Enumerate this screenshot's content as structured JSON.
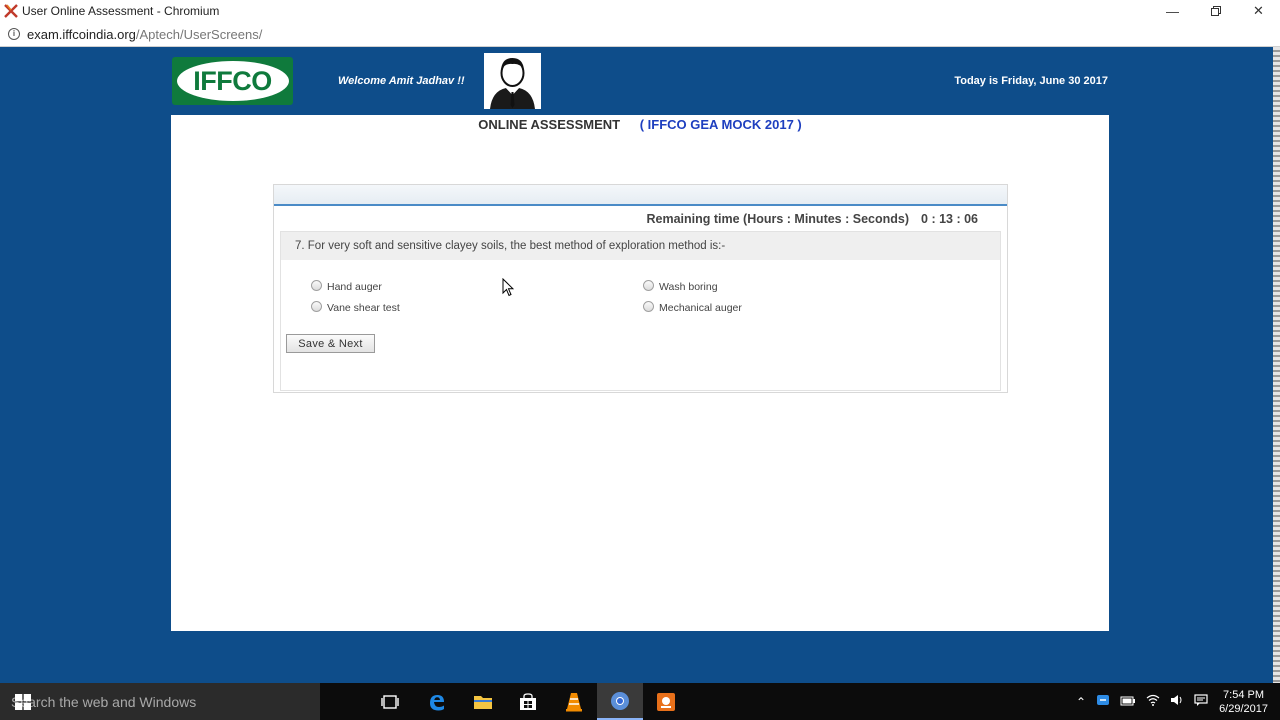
{
  "window": {
    "title": "User Online Assessment - Chromium"
  },
  "address": {
    "host": "exam.iffcoindia.org",
    "path": "/Aptech/UserScreens/"
  },
  "header": {
    "logo_text": "IFFCO",
    "welcome": "Welcome Amit Jadhav !!",
    "date": "Today is Friday, June 30 2017"
  },
  "page": {
    "heading": "ONLINE ASSESSMENT",
    "subheading": "( IFFCO GEA MOCK 2017 )"
  },
  "timer": {
    "label": "Remaining time (Hours : Minutes : Seconds)",
    "value": "0 : 13 : 06"
  },
  "question": {
    "text": "7. For very soft and sensitive clayey soils, the best method of exploration method is:-",
    "options": [
      "Hand auger",
      "Wash boring",
      "Vane shear test",
      "Mechanical auger"
    ]
  },
  "buttons": {
    "save_next": "Save & Next"
  },
  "taskbar": {
    "search_placeholder": "Search the web and Windows",
    "time": "7:54 PM",
    "date": "6/29/2017"
  },
  "colors": {
    "background": "#0e4d8a",
    "accent": "#1e3fbf",
    "logo_green": "#0f7a3c"
  }
}
